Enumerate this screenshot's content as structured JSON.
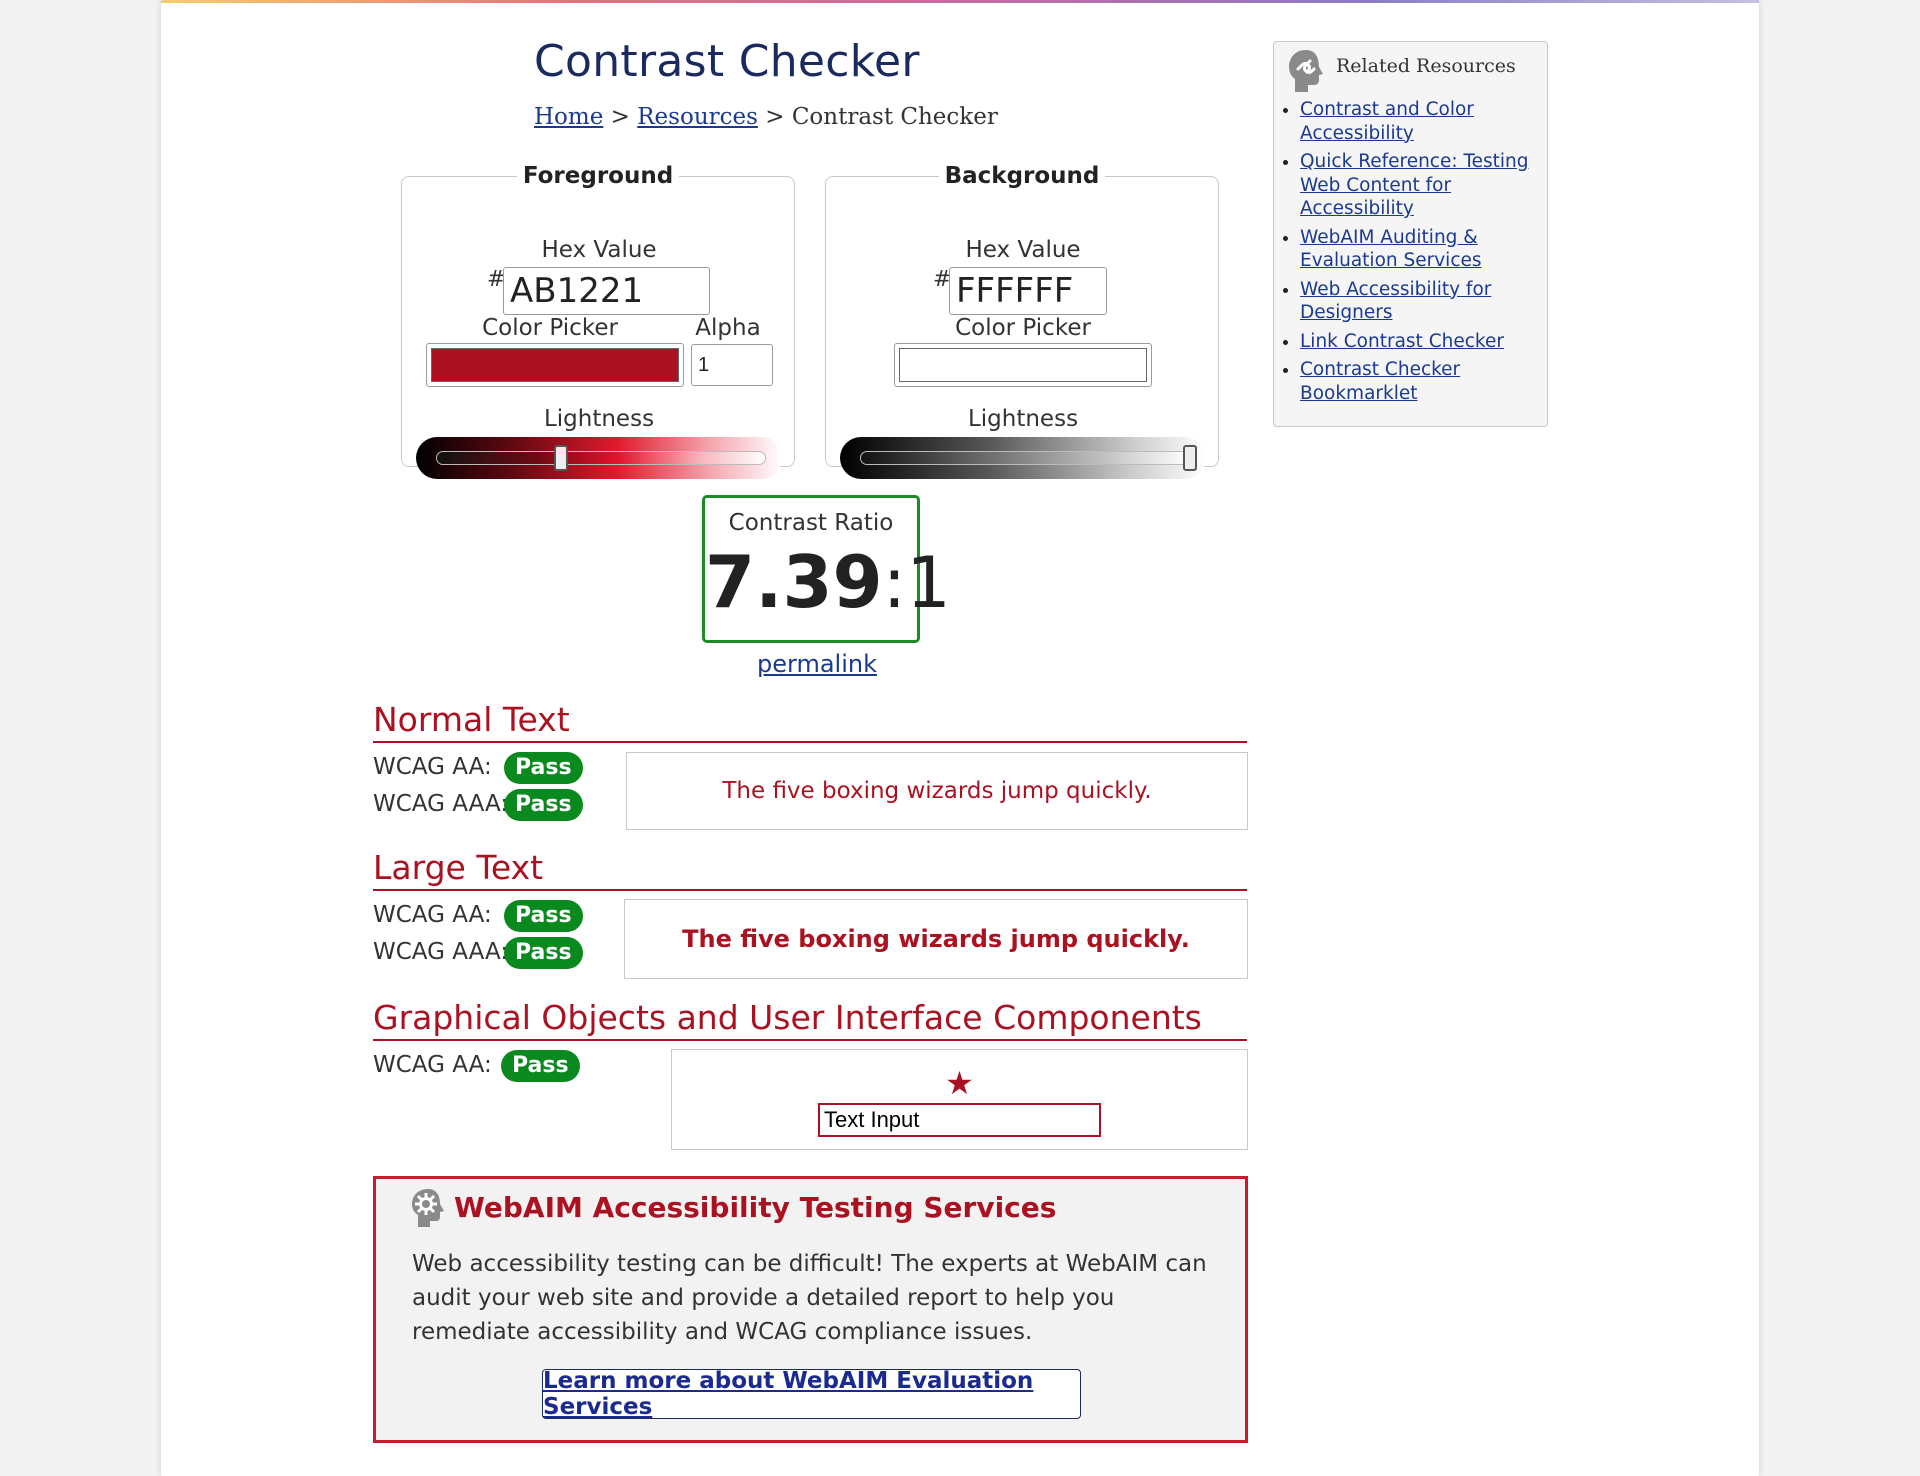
{
  "page": {
    "title": "Contrast Checker",
    "breadcrumb": {
      "home": "Home",
      "sep1": ">",
      "resources": "Resources",
      "sep2": ">",
      "current": "Contrast Checker"
    }
  },
  "foreground": {
    "legend": "Foreground",
    "hex_label": "Hex Value",
    "hash": "#",
    "hex_value": "AB1221",
    "picker_label": "Color Picker",
    "alpha_label": "Alpha",
    "alpha_value": "1",
    "lightness_label": "Lightness",
    "color": "#ab1221",
    "lightness_level": 0.38
  },
  "background": {
    "legend": "Background",
    "hex_label": "Hex Value",
    "hash": "#",
    "hex_value": "FFFFFF",
    "picker_label": "Color Picker",
    "lightness_label": "Lightness",
    "color": "#ffffff",
    "lightness_level": 1.0
  },
  "ratio": {
    "label": "Contrast Ratio",
    "value": "7.39",
    "suffix": ":1",
    "permalink": "permalink"
  },
  "normal_text": {
    "heading": "Normal Text",
    "aa_label": "WCAG AA:",
    "aa_result": "Pass",
    "aaa_label": "WCAG AAA:",
    "aaa_result": "Pass",
    "sample": "The five boxing wizards jump quickly."
  },
  "large_text": {
    "heading": "Large Text",
    "aa_label": "WCAG AA:",
    "aa_result": "Pass",
    "aaa_label": "WCAG AAA:",
    "aaa_result": "Pass",
    "sample": "The five boxing wizards jump quickly."
  },
  "graphical": {
    "heading": "Graphical Objects and User Interface Components",
    "aa_label": "WCAG AA:",
    "aa_result": "Pass",
    "star": "★",
    "input_value": "Text Input"
  },
  "services": {
    "heading": "WebAIM Accessibility Testing Services",
    "body": "Web accessibility testing can be difficult! The experts at WebAIM can audit your web site and provide a detailed report to help you remediate accessibility and WCAG compliance issues.",
    "button": "Learn more about WebAIM Evaluation Services"
  },
  "sidebar": {
    "heading": "Related Resources",
    "links": [
      "Contrast and Color Accessibility",
      "Quick Reference: Testing Web Content for Accessibility",
      "WebAIM Auditing & Evaluation Services",
      "Web Accessibility for Designers",
      "Link Contrast Checker",
      "Contrast Checker Bookmarklet"
    ]
  },
  "colors": {
    "accent_red": "#ab1221",
    "pass_green": "#0a8a1e",
    "link_blue": "#1a3a8f",
    "title_navy": "#1a2a5e"
  },
  "icons": {
    "sidebar_icon": "link-head-icon",
    "services_icon": "gear-head-icon"
  }
}
